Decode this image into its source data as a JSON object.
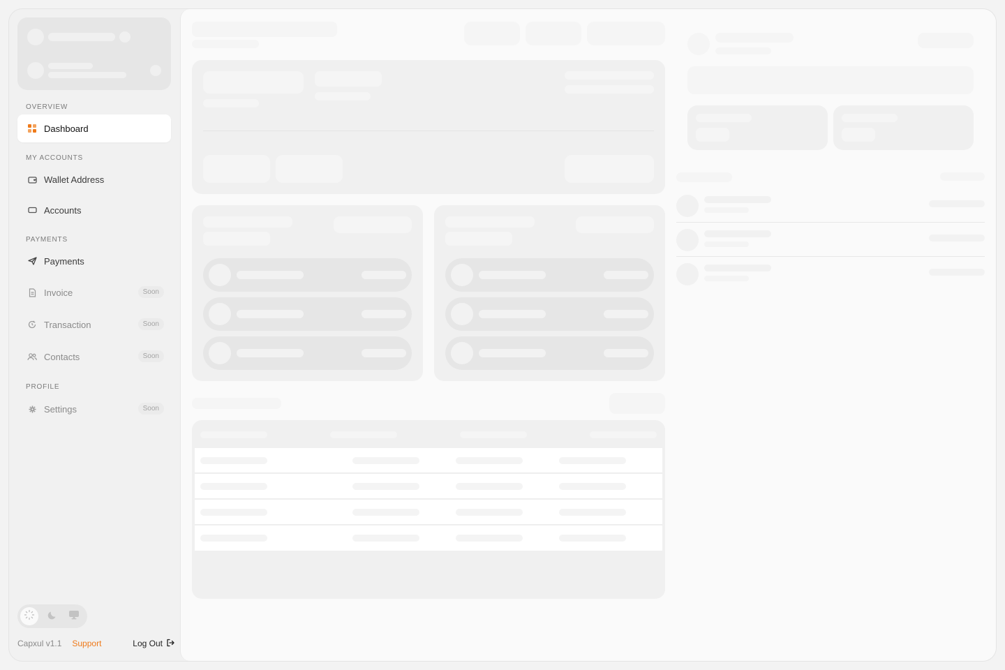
{
  "sidebar": {
    "sections": {
      "overview": "OVERVIEW",
      "my_accounts": "MY ACCOUNTS",
      "payments": "PAYMENTS",
      "profile": "PROFILE"
    },
    "items": {
      "dashboard": "Dashboard",
      "wallet_address": "Wallet Address",
      "accounts": "Accounts",
      "payments": "Payments",
      "invoice": "Invoice",
      "transaction": "Transaction",
      "contacts": "Contacts",
      "settings": "Settings"
    },
    "soon_badge": "Soon",
    "accent_color": "#ef7a1a"
  },
  "footer": {
    "version": "Capxul v1.1",
    "support": "Support",
    "logout": "Log Out"
  }
}
